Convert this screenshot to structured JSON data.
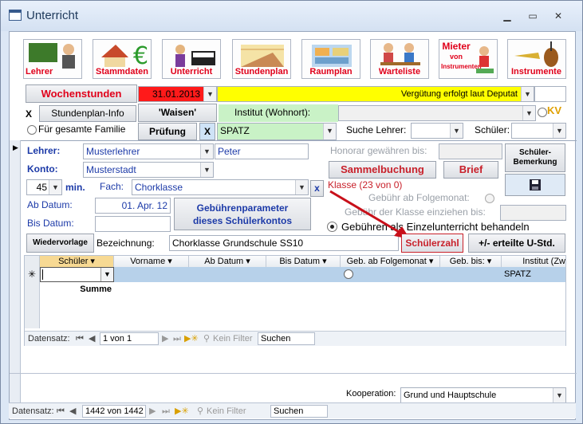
{
  "window": {
    "title": "Unterricht"
  },
  "toolbar": [
    {
      "label": "Lehrer",
      "icon": "teacher-icon"
    },
    {
      "label": "Stammdaten",
      "icon": "house-euro-icon"
    },
    {
      "label": "Unterricht",
      "icon": "lesson-icon"
    },
    {
      "label": "Stundenplan",
      "icon": "schedule-icon"
    },
    {
      "label": "Raumplan",
      "icon": "room-icon"
    },
    {
      "label": "Warteliste",
      "icon": "waitlist-icon"
    },
    {
      "label": "Instrumente",
      "icon": "instruments-icon"
    },
    {
      "label": "Instrumente",
      "icon": "instruments2-icon"
    }
  ],
  "mieter": {
    "line1": "Mieter",
    "line2": "von",
    "line3": "Instrumenten"
  },
  "row1": {
    "wochenstunden": "Wochenstunden",
    "date": "31.01.2013",
    "verguetung": "Vergütung erfolgt laut Deputat",
    "kv": "KV"
  },
  "row2": {
    "x": "X",
    "stundenplan_info": "Stundenplan-Info",
    "waisen": "'Waisen'",
    "institut_label": "Institut (Wohnort):"
  },
  "row3": {
    "familie": "Für gesamte Familie",
    "pruefung": "Prüfung",
    "x": "X",
    "spatz": "SPATZ",
    "suche_lehrer": "Suche Lehrer:",
    "schueler": "Schüler:"
  },
  "detail": {
    "lehrer_label": "Lehrer:",
    "lehrer_value": "Musterlehrer",
    "lehrer_first": "Peter",
    "konto_label": "Konto:",
    "konto_value": "Musterstadt",
    "minutes": "45",
    "min_label": "min.",
    "fach_label": "Fach:",
    "fach_value": "Chorklasse",
    "fach_x": "x",
    "ab_datum_label": "Ab Datum:",
    "ab_datum_value": "01. Apr. 12",
    "bis_datum_label": "Bis Datum:",
    "gebuehren_line1": "Gebührenparameter",
    "gebuehren_line2": "dieses Schülerkontos",
    "wiedervorlage": "Wiedervorlage",
    "bezeichnung_label": "Bezeichnung:",
    "bezeichnung_value": "Chorklasse Grundschule SS10",
    "honorar_label": "Honorar gewähren bis:",
    "sammelbuchung": "Sammelbuchung",
    "brief": "Brief",
    "schueler_bemerkung_line1": "Schüler-",
    "schueler_bemerkung_line2": "Bemerkung",
    "klasse": "Klasse (23 von 0)",
    "gebuehr_folgemonat": "Gebühr ab Folgemonat:",
    "gebuehr_klasse": "Gebühr der Klasse einziehen bis:",
    "gebuehren_einzel": "Gebühren als Einzelunterricht behandeln",
    "schuelerzahl": "Schülerzahl",
    "erteilte": "+/- erteilte U-Std."
  },
  "grid": {
    "columns": [
      "Schüler",
      "Vorname",
      "Ab Datum",
      "Bis Datum",
      "Geb. ab Folgemonat",
      "Geb. bis:",
      "Institut (Zw"
    ],
    "new_row": {
      "institut": "SPATZ"
    },
    "summe": "Summe",
    "new_marker": "✳"
  },
  "subnav": {
    "label": "Datensatz:",
    "position": "1 von 1",
    "filter": "Kein Filter",
    "search": "Suchen"
  },
  "kooperation": {
    "label": "Kooperation:",
    "value": "Grund und Hauptschule"
  },
  "mainnav": {
    "label": "Datensatz:",
    "position": "1442 von 1442",
    "filter": "Kein Filter",
    "search": "Suchen"
  }
}
